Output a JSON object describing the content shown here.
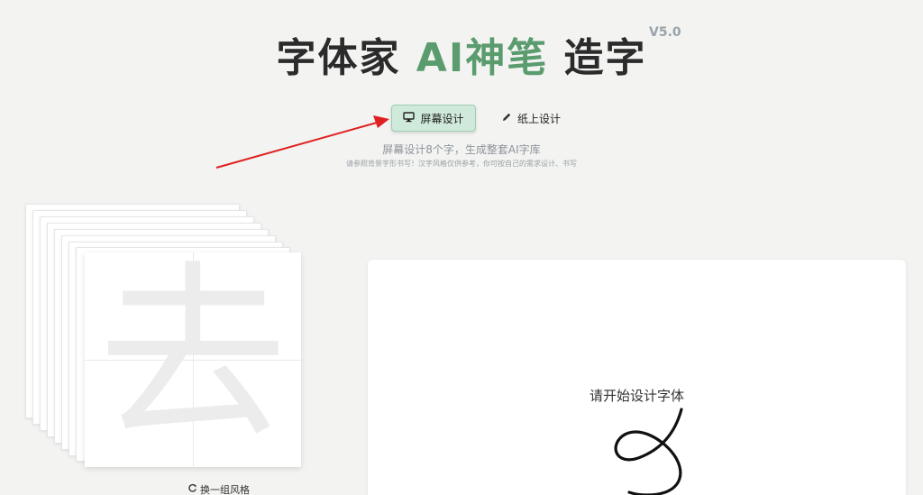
{
  "header": {
    "title_part1": "字体家",
    "title_accent": "AI神笔",
    "title_part2": "造字",
    "version": "V5.0",
    "accent_color": "#5a9c6e"
  },
  "modes": [
    {
      "label": "屏幕设计",
      "icon": "monitor-icon",
      "active": true
    },
    {
      "label": "纸上设计",
      "icon": "pencil-icon",
      "active": false
    }
  ],
  "subtitle": "屏幕设计8个字，生成整套AI字库",
  "hint": "请参照背景字形书写！汉字风格仅供参考，你可按自己的需求设计、书写",
  "sample": {
    "character": "去",
    "swap_label": "换一组风格"
  },
  "canvas": {
    "prompt": "请开始设计字体"
  }
}
